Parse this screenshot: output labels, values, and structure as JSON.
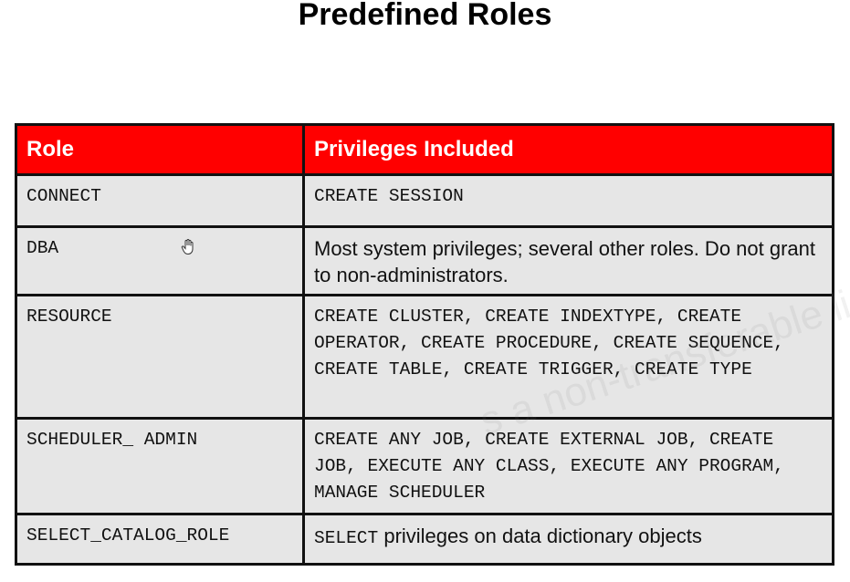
{
  "slide": {
    "title": "Predefined Roles"
  },
  "table": {
    "headers": {
      "role": "Role",
      "privileges": "Privileges Included"
    },
    "rows": [
      {
        "role": "CONNECT",
        "privileges": "CREATE SESSION",
        "privileges_style": "mono"
      },
      {
        "role": "DBA",
        "privileges": "Most system privileges; several other roles. Do not grant to non-administrators.",
        "privileges_style": "sans"
      },
      {
        "role": "RESOURCE",
        "privileges": "CREATE CLUSTER, CREATE INDEXTYPE, CREATE OPERATOR, CREATE PROCEDURE, CREATE SEQUENCE, CREATE TABLE, CREATE TRIGGER, CREATE TYPE",
        "privileges_style": "mono"
      },
      {
        "role": "SCHEDULER_ ADMIN",
        "privileges": "CREATE ANY JOB, CREATE EXTERNAL JOB, CREATE JOB, EXECUTE ANY CLASS, EXECUTE ANY PROGRAM, MANAGE SCHEDULER",
        "privileges_style": "mono"
      },
      {
        "role": "SELECT_CATALOG_ROLE",
        "privileges_keyword": "SELECT",
        "privileges_text": " privileges on data dictionary objects",
        "privileges_style": "mixed"
      }
    ]
  },
  "watermark": {
    "text": "s a non-transferable lic"
  },
  "colors": {
    "header_bg": "#ff0000",
    "header_text": "#ffffff",
    "cell_bg": "#e6e6e6",
    "border": "#111111"
  },
  "icons": {
    "cursor": "hand-cursor-icon"
  }
}
